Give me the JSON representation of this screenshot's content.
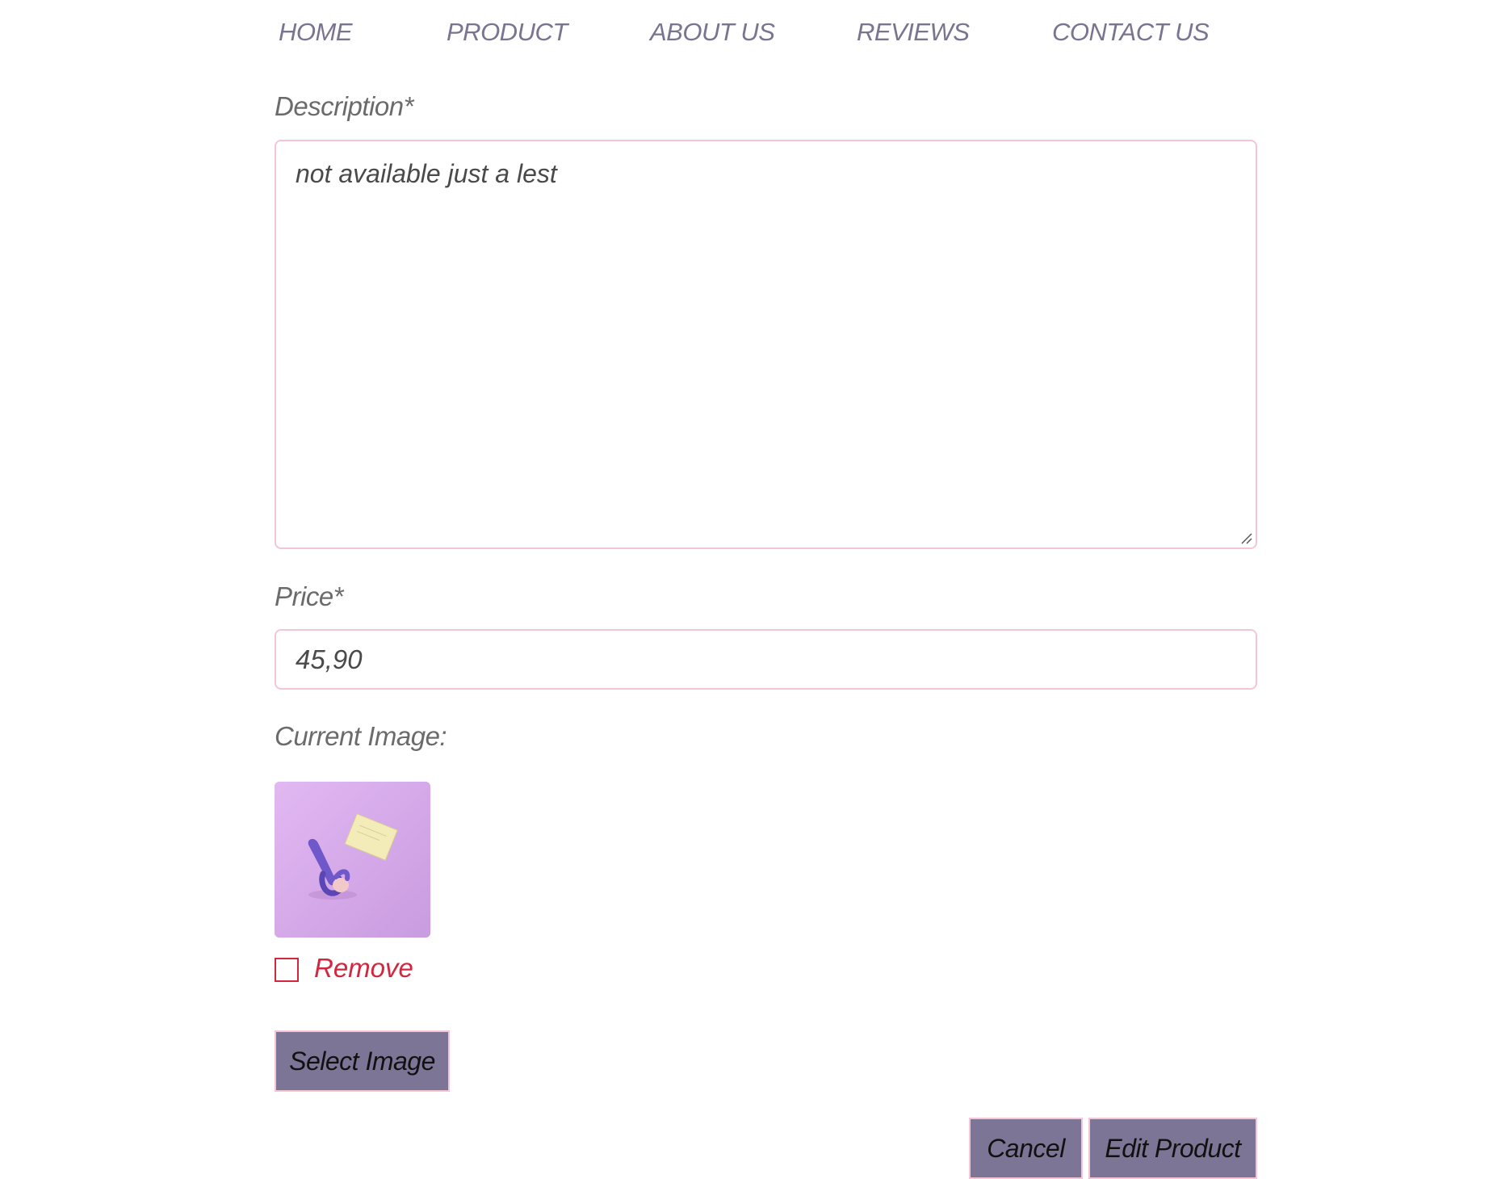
{
  "nav": {
    "items": [
      {
        "label": "HOME"
      },
      {
        "label": "PRODUCT"
      },
      {
        "label": "ABOUT US"
      },
      {
        "label": "REVIEWS"
      },
      {
        "label": "CONTACT US"
      }
    ]
  },
  "form": {
    "description": {
      "label": "Description*",
      "value": "not available just a lest"
    },
    "price": {
      "label": "Price*",
      "value": "45,90"
    },
    "current_image": {
      "label": "Current Image:",
      "remove_label": "Remove",
      "remove_checked": false
    },
    "select_image_label": "Select Image",
    "cancel_label": "Cancel",
    "submit_label": "Edit Product"
  },
  "colors": {
    "nav_text": "#7a7490",
    "label_text": "#6b6b6b",
    "field_border": "#f4c6d3",
    "button_bg": "#7d7596",
    "remove_red": "#d3273f",
    "thumb_bg": "#d9aee8"
  }
}
